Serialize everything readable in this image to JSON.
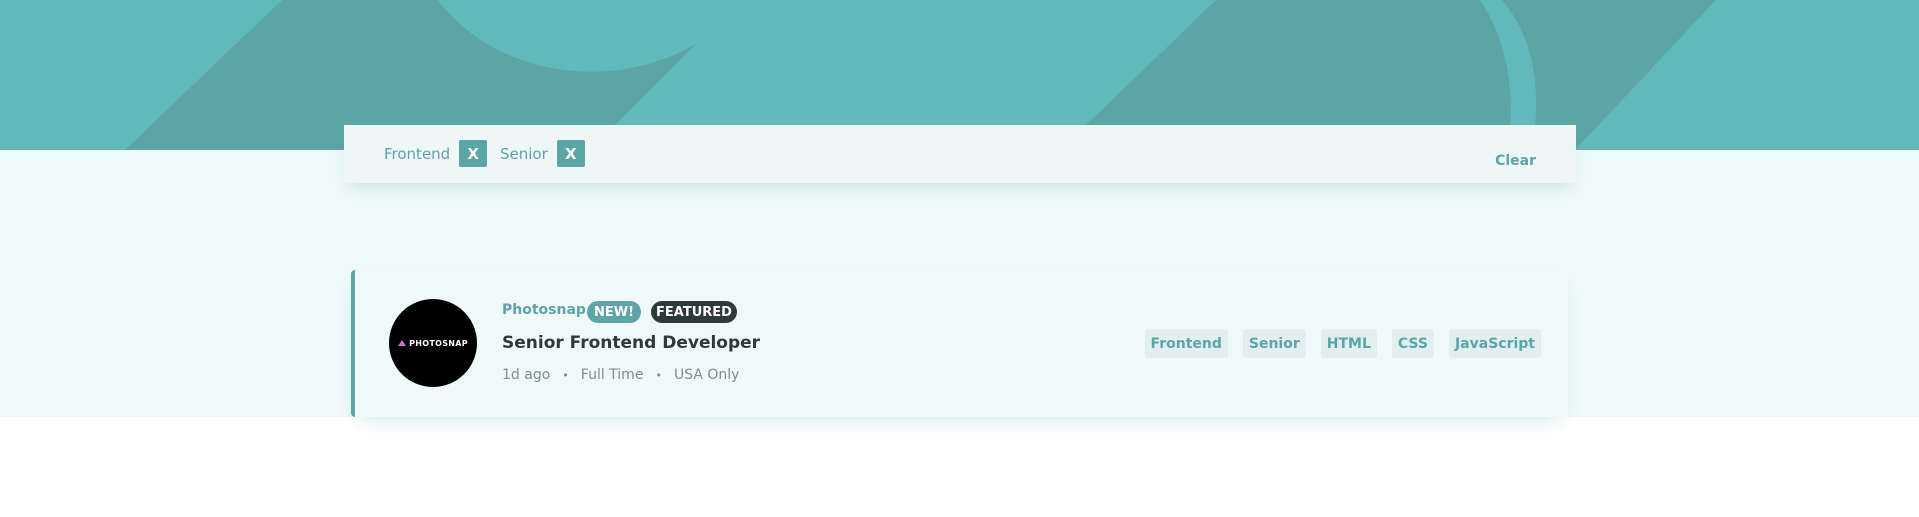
{
  "filters": {
    "items": [
      {
        "label": "Frontend",
        "remove_label": "X"
      },
      {
        "label": "Senior",
        "remove_label": "X"
      }
    ],
    "clear_label": "Clear"
  },
  "job": {
    "company": "Photosnap",
    "logo_text": "PHOTOSNAP",
    "badges": {
      "new": "NEW!",
      "featured": "FEATURED"
    },
    "title": "Senior Frontend Developer",
    "posted": "1d ago",
    "contract": "Full Time",
    "location": "USA Only",
    "meta_separator": "•",
    "tags": [
      "Frontend",
      "Senior",
      "HTML",
      "CSS",
      "JavaScript"
    ]
  },
  "colors": {
    "primary": "#5ca5a5",
    "header": "#62b9ba",
    "background": "#eef9f9",
    "dark": "#2c3a3a",
    "logo_accent": "#d46cdc"
  }
}
